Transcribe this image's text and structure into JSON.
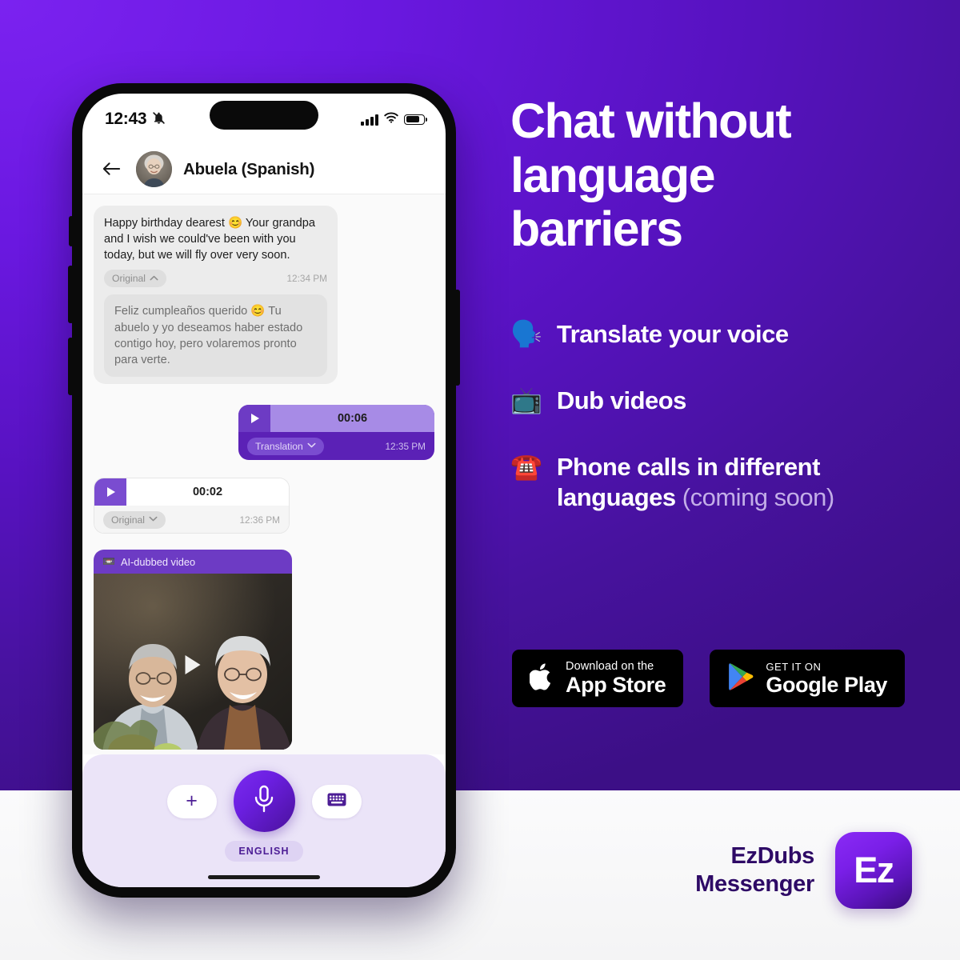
{
  "background": {
    "purple": "#6B1FE0",
    "deep_purple": "#3C0F86",
    "white_band": "#FAFAFA"
  },
  "phone": {
    "status_bar": {
      "time": "12:43",
      "bell_icon": "bell-slash-icon",
      "signal_icon": "signal-bars-icon",
      "wifi_icon": "wifi-icon",
      "battery_icon": "battery-icon"
    },
    "chat_header": {
      "back_icon": "back-arrow-icon",
      "avatar": "contact-avatar",
      "contact_name": "Abuela (Spanish)"
    },
    "messages": [
      {
        "type": "text",
        "direction": "incoming",
        "text": "Happy birthday dearest 😊 Your grandpa and I wish we could've been with you today, but we will fly over very soon.",
        "pill_label": "Original",
        "pill_chevron": "ⱏ",
        "time": "12:34 PM",
        "translation": "Feliz cumpleaños querido 😊 Tu abuelo y yo deseamos haber estado contigo hoy, pero volaremos pronto para verte."
      },
      {
        "type": "voice",
        "direction": "outgoing",
        "duration": "00:06",
        "pill_label": "Translation",
        "pill_chevron": "ⱟ",
        "time": "12:35 PM"
      },
      {
        "type": "voice",
        "direction": "incoming",
        "duration": "00:02",
        "pill_label": "Original",
        "pill_chevron": "ⱟ",
        "time": "12:36 PM"
      },
      {
        "type": "video",
        "direction": "incoming",
        "header_icon": "📼",
        "header_label": "AI-dubbed video"
      }
    ],
    "input_bar": {
      "plus_label": "+",
      "plus_icon": "plus-icon",
      "mic_icon": "microphone-icon",
      "keyboard_icon": "keyboard-icon",
      "language": "ENGLISH"
    }
  },
  "headline": {
    "line1": "Chat without",
    "line2": "language",
    "line3": "barriers"
  },
  "features": [
    {
      "icon": "🗣️",
      "icon_name": "speaking-head-icon",
      "text": "Translate your voice",
      "note": ""
    },
    {
      "icon": "📺",
      "icon_name": "television-icon",
      "text": "Dub videos",
      "note": ""
    },
    {
      "icon": "☎️",
      "icon_name": "telephone-icon",
      "text": "Phone calls in different languages",
      "note": "(coming soon)"
    }
  ],
  "store_badges": [
    {
      "icon": "apple-logo-icon",
      "small": "Download on the",
      "big": "App Store"
    },
    {
      "icon": "google-play-icon",
      "small": "GET IT ON",
      "big": "Google Play"
    }
  ],
  "brand": {
    "line1": "EzDubs",
    "line2": "Messenger",
    "icon_text": "Ez"
  }
}
